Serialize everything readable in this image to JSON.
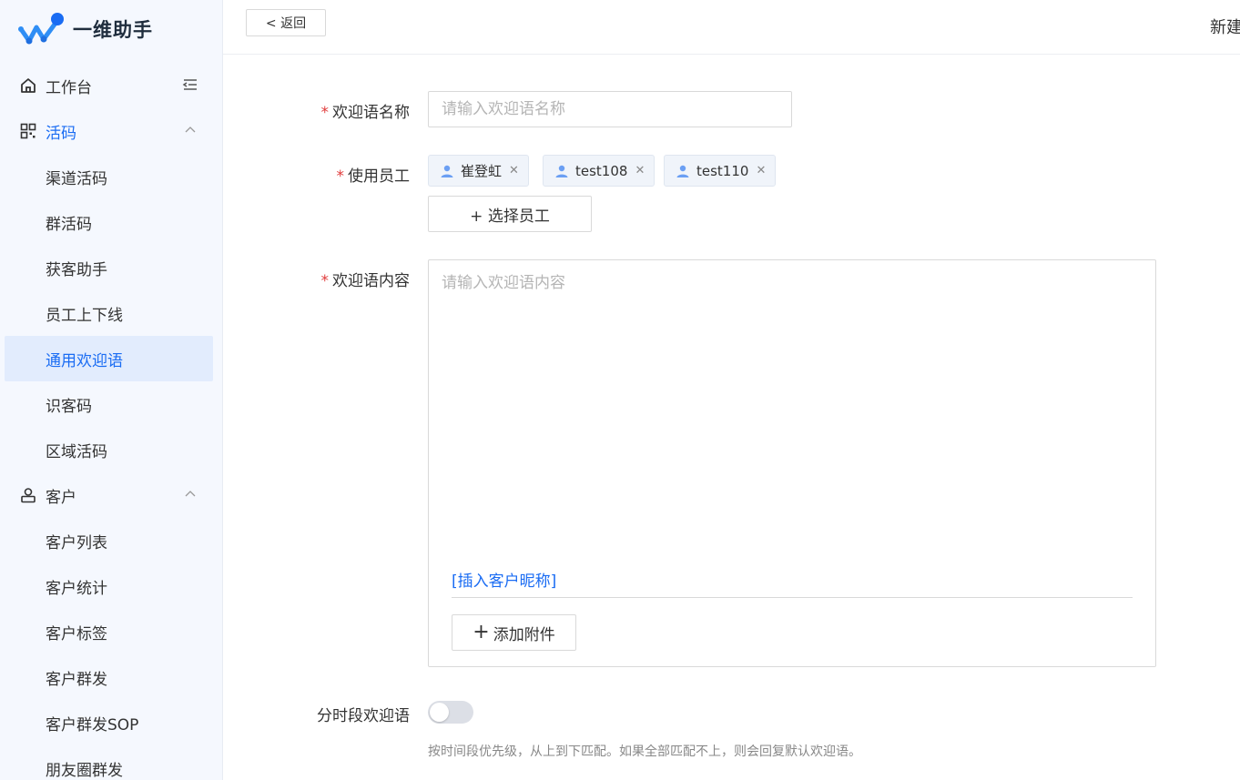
{
  "brand": {
    "name": "一维助手",
    "accent": "#1a6cf3"
  },
  "sidebar": {
    "workbench": {
      "label": "工作台",
      "icon": "home-icon"
    },
    "groups": [
      {
        "label": "活码",
        "icon": "qrcode-icon",
        "items": [
          "渠道活码",
          "群活码",
          "获客助手",
          "员工上下线",
          "通用欢迎语",
          "识客码",
          "区域活码"
        ],
        "selected": "通用欢迎语"
      },
      {
        "label": "客户",
        "icon": "customer-icon",
        "items": [
          "客户列表",
          "客户统计",
          "客户标签",
          "客户群发",
          "客户群发SOP",
          "朋友圈群发"
        ]
      }
    ]
  },
  "header": {
    "back_label": "< 返回",
    "title": "新建"
  },
  "form": {
    "name": {
      "label": "欢迎语名称",
      "placeholder": "请输入欢迎语名称",
      "value": ""
    },
    "staff": {
      "label": "使用员工",
      "tags": [
        "崔登虹",
        "test108",
        "test110"
      ],
      "select_label": "+ 选择员工"
    },
    "content": {
      "label": "欢迎语内容",
      "placeholder": "请输入欢迎语内容",
      "insert_nickname": "[插入客户昵称]",
      "add_attachment": "添加附件"
    },
    "timed": {
      "label": "分时段欢迎语",
      "enabled": false,
      "hint": "按时间段优先级，从上到下匹配。如果全部匹配不上，则会回复默认欢迎语。"
    }
  }
}
